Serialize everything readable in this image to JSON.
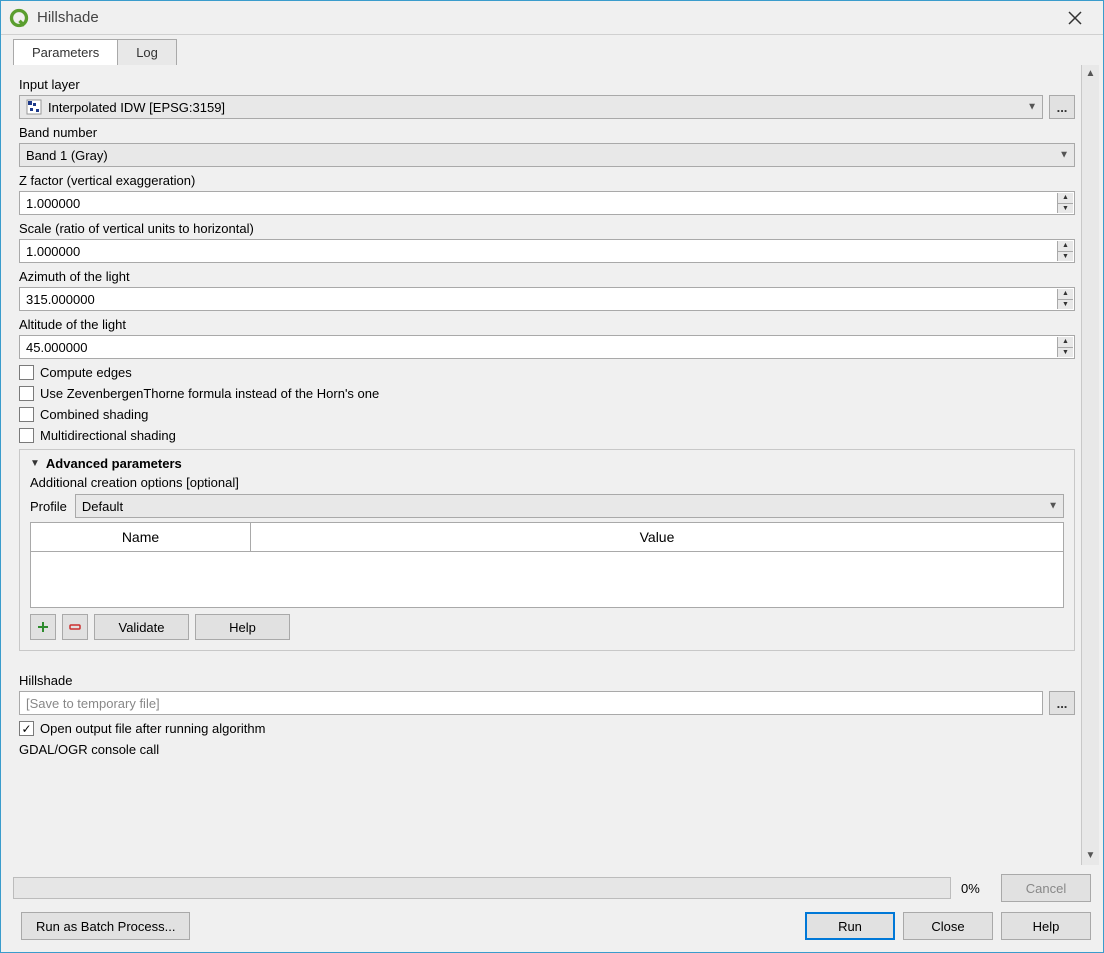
{
  "window": {
    "title": "Hillshade"
  },
  "tabs": {
    "parameters": "Parameters",
    "log": "Log"
  },
  "labels": {
    "input_layer": "Input layer",
    "band_number": "Band number",
    "z_factor": "Z factor (vertical exaggeration)",
    "scale": "Scale (ratio of vertical units to horizontal)",
    "azimuth": "Azimuth of the light",
    "altitude": "Altitude of the light",
    "advanced": "Advanced parameters",
    "additional_options": "Additional creation options [optional]",
    "profile": "Profile",
    "name_col": "Name",
    "value_col": "Value",
    "output": "Hillshade",
    "open_output": "Open output file after running algorithm",
    "console_call": "GDAL/OGR console call"
  },
  "checks": {
    "compute_edges": "Compute edges",
    "zevenbergen": "Use ZevenbergenThorne formula instead of the Horn's one",
    "combined": "Combined shading",
    "multidirectional": "Multidirectional shading"
  },
  "values": {
    "input_layer": "Interpolated IDW [EPSG:3159]",
    "band_number": "Band 1 (Gray)",
    "z_factor": "1.000000",
    "scale": "1.000000",
    "azimuth": "315.000000",
    "altitude": "45.000000",
    "profile": "Default",
    "output_placeholder": "[Save to temporary file]"
  },
  "buttons": {
    "validate": "Validate",
    "help_small": "Help",
    "browse": "...",
    "cancel": "Cancel",
    "run_batch": "Run as Batch Process...",
    "run": "Run",
    "close": "Close",
    "help": "Help"
  },
  "progress": {
    "percent": "0%"
  }
}
